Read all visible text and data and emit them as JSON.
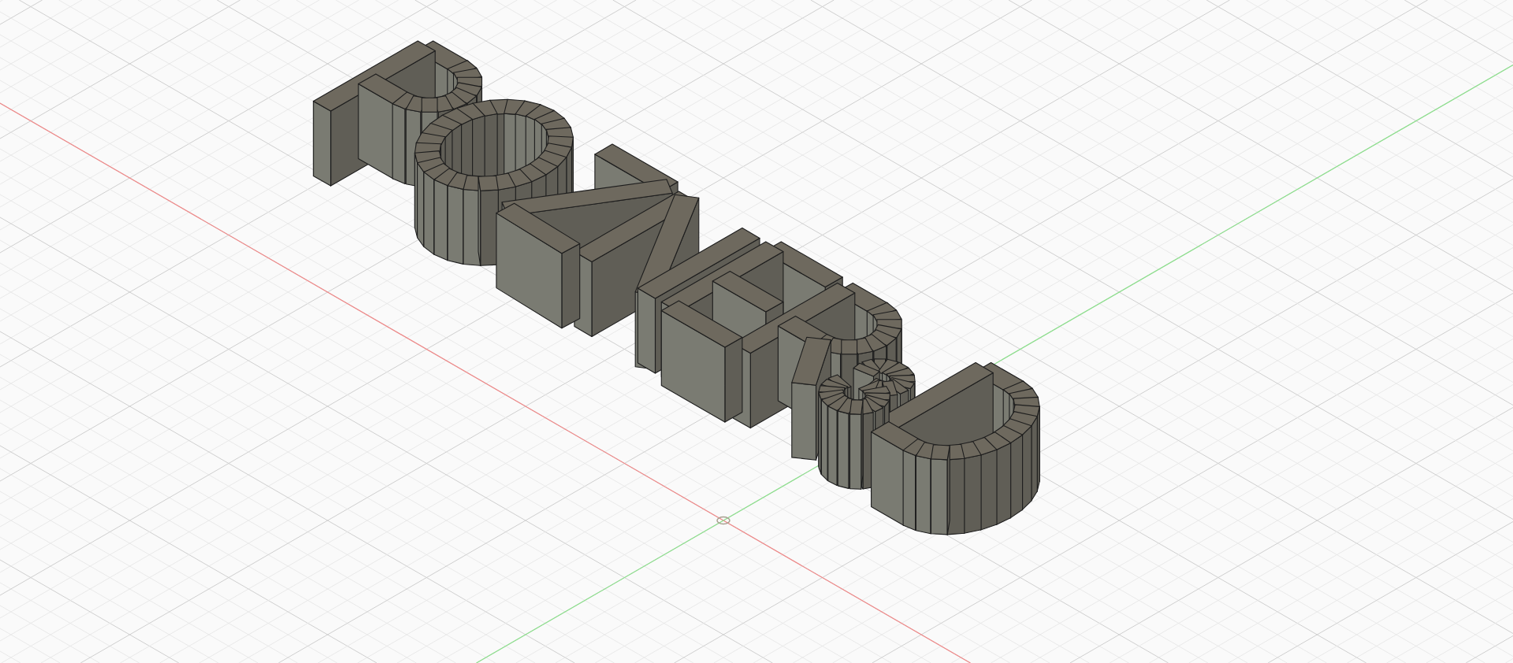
{
  "viewport": {
    "grid": true,
    "axes": [
      {
        "kind": "x",
        "color": "#f08a8a"
      },
      {
        "kind": "y",
        "color": "#8ee08e"
      }
    ],
    "origin_marker": true
  }
}
